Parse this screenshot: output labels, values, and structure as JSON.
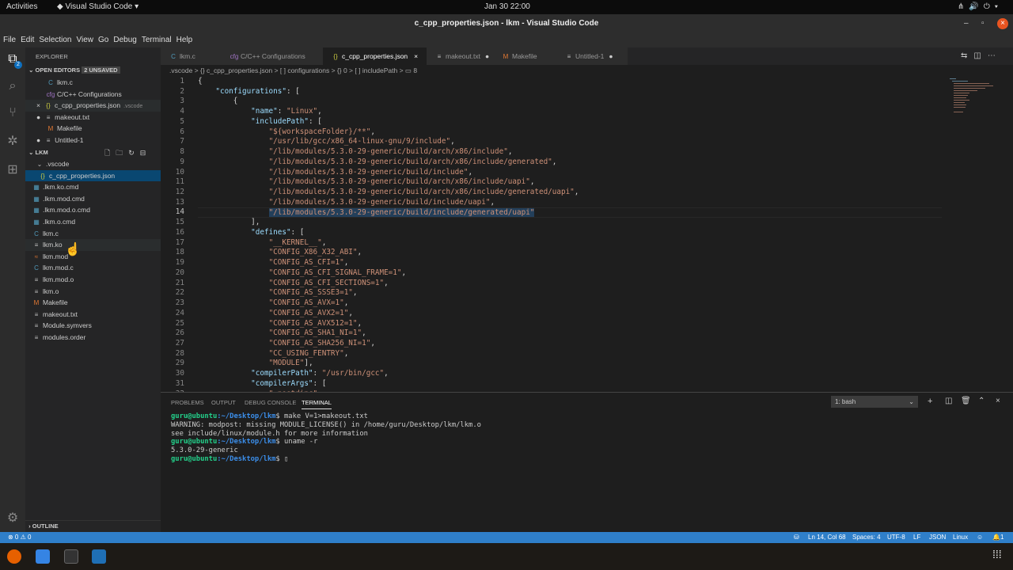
{
  "os": {
    "activities": "Activities",
    "app_menu": "Visual Studio Code",
    "clock": "Jan 30  22:00"
  },
  "window": {
    "title": "c_cpp_properties.json - lkm - Visual Studio Code"
  },
  "menu": [
    "File",
    "Edit",
    "Selection",
    "View",
    "Go",
    "Debug",
    "Terminal",
    "Help"
  ],
  "activity": {
    "explorer_badge": "2"
  },
  "sidebar": {
    "title": "EXPLORER",
    "open_editors": {
      "label": "OPEN EDITORS",
      "badge": "2 UNSAVED",
      "items": [
        {
          "name": "lkm.c",
          "icon": "C"
        },
        {
          "name": "C/C++ Configurations",
          "icon": "cfg"
        },
        {
          "name": "c_cpp_properties.json",
          "hint": ".vscode",
          "icon": "{}"
        },
        {
          "name": "makeout.txt",
          "icon": "≡"
        },
        {
          "name": "Makefile",
          "icon": "M"
        },
        {
          "name": "Untitled-1",
          "icon": "≡"
        }
      ]
    },
    "folder": {
      "label": "LKM",
      "items": [
        {
          "name": ".vscode",
          "icon": "⌄"
        },
        {
          "name": "c_cpp_properties.json",
          "icon": "{}"
        },
        {
          "name": ".lkm.ko.cmd",
          "icon": "▦"
        },
        {
          "name": ".lkm.mod.cmd",
          "icon": "▦"
        },
        {
          "name": ".lkm.mod.o.cmd",
          "icon": "▦"
        },
        {
          "name": ".lkm.o.cmd",
          "icon": "▦"
        },
        {
          "name": "lkm.c",
          "icon": "C"
        },
        {
          "name": "lkm.ko",
          "icon": "≡"
        },
        {
          "name": "lkm.mod",
          "icon": "≈"
        },
        {
          "name": "lkm.mod.c",
          "icon": "C"
        },
        {
          "name": "lkm.mod.o",
          "icon": "≡"
        },
        {
          "name": "lkm.o",
          "icon": "≡"
        },
        {
          "name": "Makefile",
          "icon": "M"
        },
        {
          "name": "makeout.txt",
          "icon": "≡"
        },
        {
          "name": "Module.symvers",
          "icon": "≡"
        },
        {
          "name": "modules.order",
          "icon": "≡"
        }
      ]
    },
    "outline": "OUTLINE"
  },
  "tabs": [
    {
      "label": "lkm.c",
      "icon": "C"
    },
    {
      "label": "C/C++ Configurations",
      "icon": "cfg"
    },
    {
      "label": "c_cpp_properties.json",
      "icon": "{}",
      "close": "×"
    },
    {
      "label": "makeout.txt",
      "icon": "≡",
      "dot": "●"
    },
    {
      "label": "Makefile",
      "icon": "M"
    },
    {
      "label": "Untitled-1",
      "icon": "≡",
      "dot": "●"
    }
  ],
  "breadcrumbs": ".vscode > {} c_cpp_properties.json > [ ] configurations > {} 0 > [ ] includePath > ▭ 8",
  "code": [
    [
      [
        "p",
        "{"
      ]
    ],
    [
      [
        "p",
        "    "
      ],
      [
        "k",
        "\"configurations\""
      ],
      [
        "p",
        ": ["
      ]
    ],
    [
      [
        "p",
        "        {"
      ]
    ],
    [
      [
        "p",
        "            "
      ],
      [
        "k",
        "\"name\""
      ],
      [
        "p",
        ": "
      ],
      [
        "s",
        "\"Linux\""
      ],
      [
        "p",
        ","
      ]
    ],
    [
      [
        "p",
        "            "
      ],
      [
        "k",
        "\"includePath\""
      ],
      [
        "p",
        ": ["
      ]
    ],
    [
      [
        "p",
        "                "
      ],
      [
        "s",
        "\"${workspaceFolder}/**\""
      ],
      [
        "p",
        ","
      ]
    ],
    [
      [
        "p",
        "                "
      ],
      [
        "s",
        "\"/usr/lib/gcc/x86_64-linux-gnu/9/include\""
      ],
      [
        "p",
        ","
      ]
    ],
    [
      [
        "p",
        "                "
      ],
      [
        "s",
        "\"/lib/modules/5.3.0-29-generic/build/arch/x86/include\""
      ],
      [
        "p",
        ","
      ]
    ],
    [
      [
        "p",
        "                "
      ],
      [
        "s",
        "\"/lib/modules/5.3.0-29-generic/build/arch/x86/include/generated\""
      ],
      [
        "p",
        ","
      ]
    ],
    [
      [
        "p",
        "                "
      ],
      [
        "s",
        "\"/lib/modules/5.3.0-29-generic/build/include\""
      ],
      [
        "p",
        ","
      ]
    ],
    [
      [
        "p",
        "                "
      ],
      [
        "s",
        "\"/lib/modules/5.3.0-29-generic/build/arch/x86/include/uapi\""
      ],
      [
        "p",
        ","
      ]
    ],
    [
      [
        "p",
        "                "
      ],
      [
        "s",
        "\"/lib/modules/5.3.0-29-generic/build/arch/x86/include/generated/uapi\""
      ],
      [
        "p",
        ","
      ]
    ],
    [
      [
        "p",
        "                "
      ],
      [
        "s",
        "\"/lib/modules/5.3.0-29-generic/build/include/uapi\""
      ],
      [
        "p",
        ","
      ]
    ],
    [
      [
        "p",
        "                "
      ],
      [
        "s",
        "\"/lib/modules/5.3.0-29-generic/build/include/generated/uapi\""
      ]
    ],
    [
      [
        "p",
        "            ],"
      ]
    ],
    [
      [
        "p",
        "            "
      ],
      [
        "k",
        "\"defines\""
      ],
      [
        "p",
        ": ["
      ]
    ],
    [
      [
        "p",
        "                "
      ],
      [
        "s",
        "\"__KERNEL__\""
      ],
      [
        "p",
        ","
      ]
    ],
    [
      [
        "p",
        "                "
      ],
      [
        "s",
        "\"CONFIG_X86_X32_ABI\""
      ],
      [
        "p",
        ","
      ]
    ],
    [
      [
        "p",
        "                "
      ],
      [
        "s",
        "\"CONFIG_AS_CFI=1\""
      ],
      [
        "p",
        ","
      ]
    ],
    [
      [
        "p",
        "                "
      ],
      [
        "s",
        "\"CONFIG_AS_CFI_SIGNAL_FRAME=1\""
      ],
      [
        "p",
        ","
      ]
    ],
    [
      [
        "p",
        "                "
      ],
      [
        "s",
        "\"CONFIG_AS_CFI_SECTIONS=1\""
      ],
      [
        "p",
        ","
      ]
    ],
    [
      [
        "p",
        "                "
      ],
      [
        "s",
        "\"CONFIG_AS_SSSE3=1\""
      ],
      [
        "p",
        ","
      ]
    ],
    [
      [
        "p",
        "                "
      ],
      [
        "s",
        "\"CONFIG_AS_AVX=1\""
      ],
      [
        "p",
        ","
      ]
    ],
    [
      [
        "p",
        "                "
      ],
      [
        "s",
        "\"CONFIG_AS_AVX2=1\""
      ],
      [
        "p",
        ","
      ]
    ],
    [
      [
        "p",
        "                "
      ],
      [
        "s",
        "\"CONFIG_AS_AVX512=1\""
      ],
      [
        "p",
        ","
      ]
    ],
    [
      [
        "p",
        "                "
      ],
      [
        "s",
        "\"CONFIG_AS_SHA1_NI=1\""
      ],
      [
        "p",
        ","
      ]
    ],
    [
      [
        "p",
        "                "
      ],
      [
        "s",
        "\"CONFIG_AS_SHA256_NI=1\""
      ],
      [
        "p",
        ","
      ]
    ],
    [
      [
        "p",
        "                "
      ],
      [
        "s",
        "\"CC_USING_FENTRY\""
      ],
      [
        "p",
        ","
      ]
    ],
    [
      [
        "p",
        "                "
      ],
      [
        "s",
        "\"MODULE\""
      ],
      [
        "p",
        "],"
      ]
    ],
    [
      [
        "p",
        "            "
      ],
      [
        "k",
        "\"compilerPath\""
      ],
      [
        "p",
        ": "
      ],
      [
        "s",
        "\"/usr/bin/gcc\""
      ],
      [
        "p",
        ","
      ]
    ],
    [
      [
        "p",
        "            "
      ],
      [
        "k",
        "\"compilerArgs\""
      ],
      [
        "p",
        ": ["
      ]
    ],
    [
      [
        "p",
        "                "
      ],
      [
        "s",
        "\"-nostdinc\""
      ]
    ]
  ],
  "panel": {
    "tabs": [
      "PROBLEMS",
      "OUTPUT",
      "DEBUG CONSOLE",
      "TERMINAL"
    ],
    "terminal_select": "1: bash",
    "lines": [
      {
        "user": "guru@ubuntu",
        "path": ":~/Desktop/lkm",
        "cmd": "$ make V=1>makeout.txt"
      },
      {
        "text": "WARNING: modpost: missing MODULE_LICENSE() in /home/guru/Desktop/lkm/lkm.o"
      },
      {
        "text": "see include/linux/module.h for more information"
      },
      {
        "user": "guru@ubuntu",
        "path": ":~/Desktop/lkm",
        "cmd": "$ uname -r"
      },
      {
        "text": "5.3.0-29-generic"
      },
      {
        "user": "guru@ubuntu",
        "path": ":~/Desktop/lkm",
        "cmd": "$ ▯"
      }
    ]
  },
  "status": {
    "errors": "⊗ 0 ⚠ 0",
    "position": "Ln 14, Col 68",
    "spaces": "Spaces: 4",
    "encoding": "UTF-8",
    "eol": "LF",
    "language": "JSON",
    "config": "Linux",
    "notifications": "1"
  }
}
